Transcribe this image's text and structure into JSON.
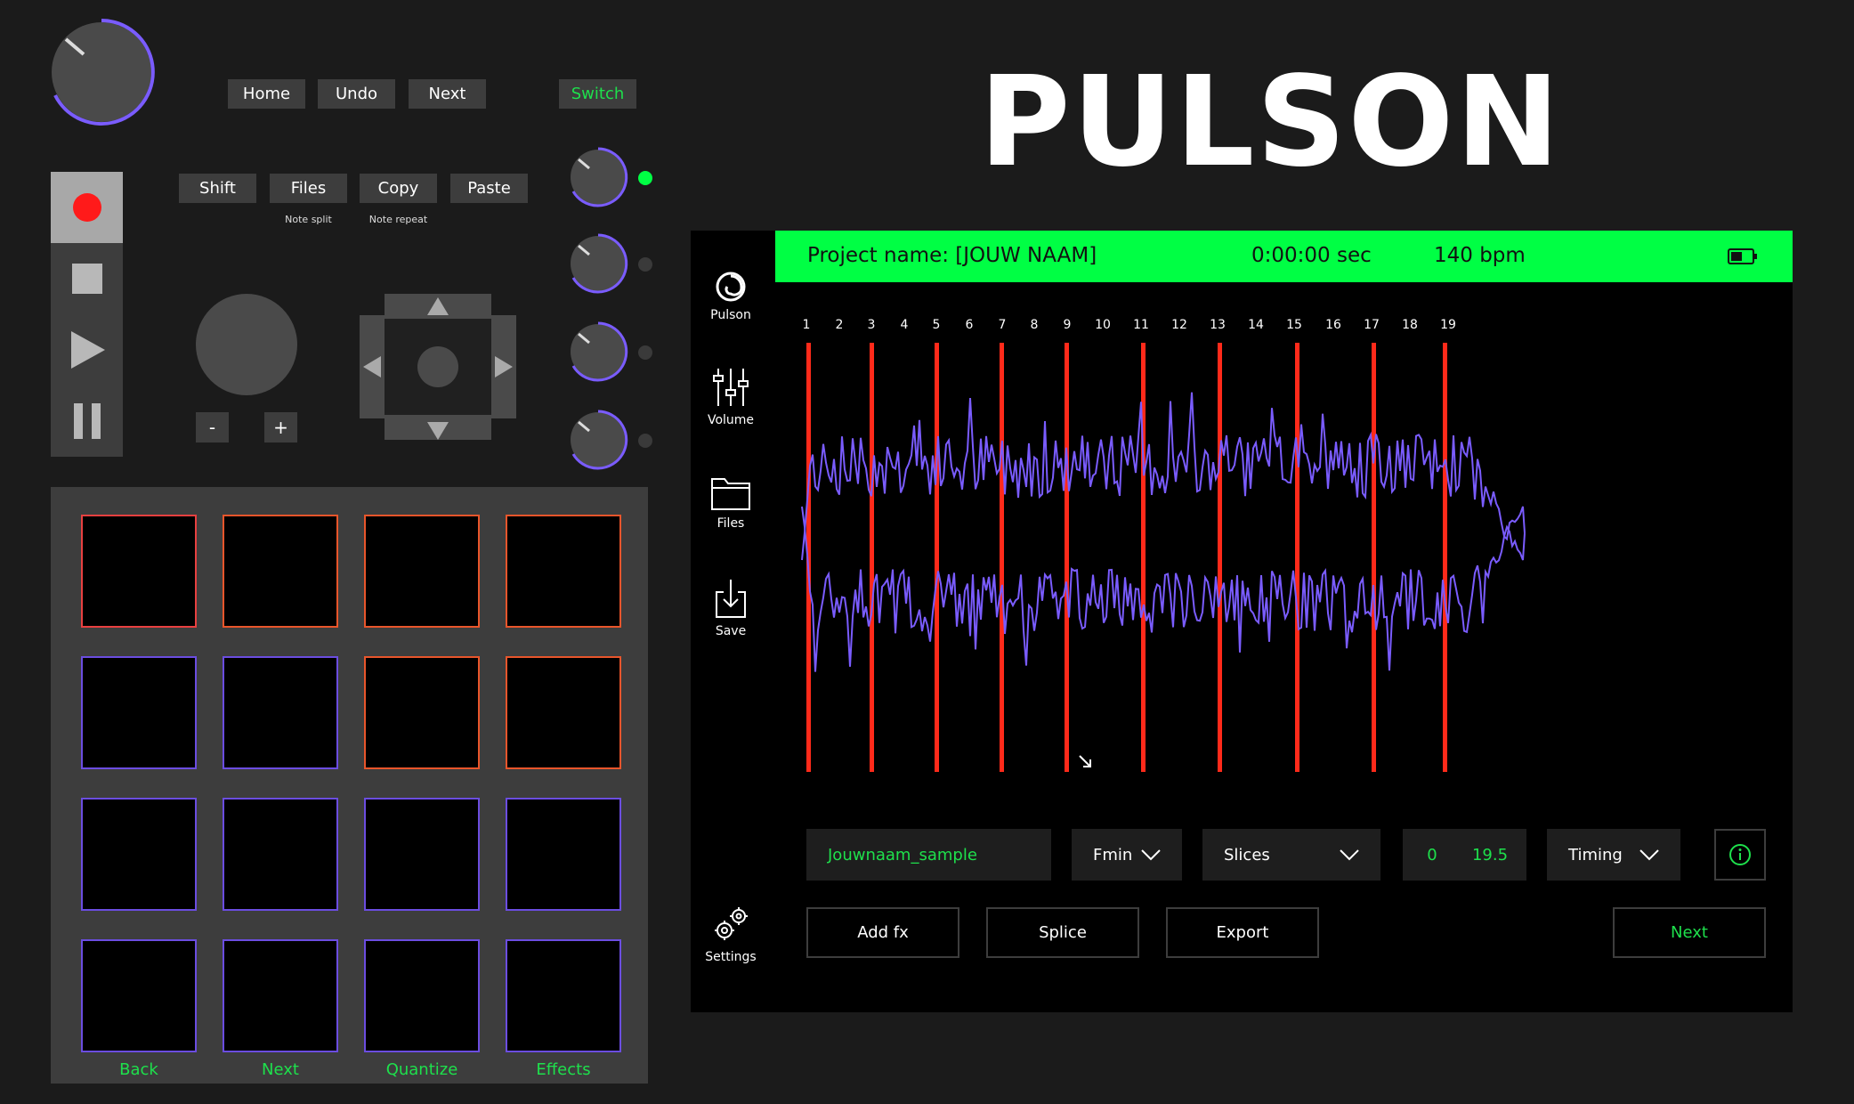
{
  "brand": {
    "logo": "PULSON"
  },
  "top_buttons": {
    "home": "Home",
    "undo": "Undo",
    "next": "Next",
    "switch": "Switch"
  },
  "edit_buttons": {
    "shift": "Shift",
    "files": "Files",
    "copy": "Copy",
    "paste": "Paste",
    "files_sub": "Note split",
    "copy_sub": "Note repeat"
  },
  "jog": {
    "minus": "-",
    "plus": "+"
  },
  "pad_labels": {
    "back": "Back",
    "next": "Next",
    "quantize": "Quantize",
    "effects": "Effects"
  },
  "screen": {
    "project_name": "Project name: [JOUW NAAM]",
    "time": "0:00:00 sec",
    "bpm": "140 bpm",
    "sidebar": {
      "pulson": "Pulson",
      "volume": "Volume",
      "files": "Files",
      "save": "Save",
      "settings": "Settings"
    },
    "slice_numbers": [
      "1",
      "2",
      "3",
      "4",
      "5",
      "6",
      "7",
      "8",
      "9",
      "10",
      "11",
      "12",
      "13",
      "14",
      "15",
      "16",
      "17",
      "18",
      "19"
    ],
    "controls": {
      "sample_name": "Jouwnaam_sample",
      "key": "Fmin",
      "mode": "Slices",
      "start": "0",
      "end": "19.5",
      "timing": "Timing"
    },
    "buttons": {
      "add_fx": "Add fx",
      "splice": "Splice",
      "export": "Export",
      "next": "Next"
    }
  },
  "colors": {
    "accent_green": "#00ff44",
    "slice_red": "#ff2a1a",
    "wave_purple": "#7a5cff",
    "panel_gray": "#3d3d3d"
  }
}
